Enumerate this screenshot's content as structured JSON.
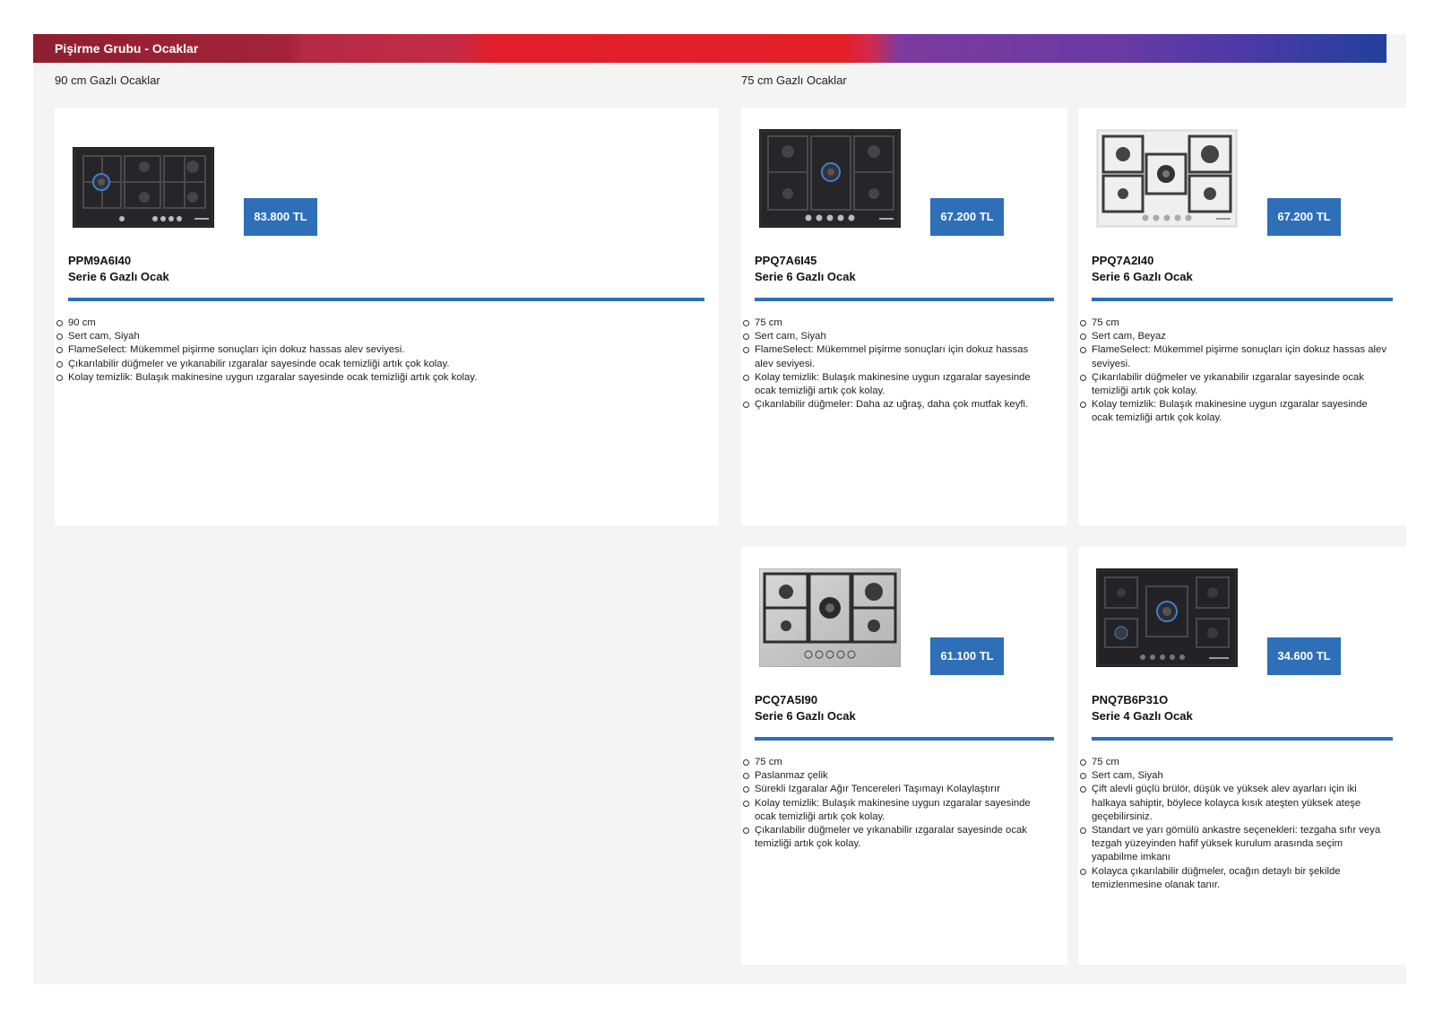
{
  "header": {
    "title": "Pişirme Grubu - Ocaklar"
  },
  "sections": {
    "left": "90 cm Gazlı Ocaklar",
    "right": "75 cm Gazlı Ocaklar"
  },
  "colors": {
    "accent": "#2e6fb7",
    "page_background": "#f4f4f5"
  },
  "products": [
    {
      "price": "83.800 TL",
      "model": "PPM9A6I40",
      "name": "Serie 6 Gazlı Ocak",
      "image": "black-glass-gas-hob",
      "features": [
        "90 cm",
        "Sert cam, Siyah",
        "FlameSelect: Mükemmel pişirme sonuçları için dokuz hassas alev seviyesi.",
        "Çıkarılabilir düğmeler ve yıkanabilir ızgaralar sayesinde ocak temizliği artık çok kolay.",
        "Kolay temizlik: Bulaşık makinesine uygun ızgaralar sayesinde ocak temizliği artık çok kolay."
      ]
    },
    {
      "price": "67.200 TL",
      "model": "PPQ7A6I45",
      "name": "Serie 6 Gazlı Ocak",
      "image": "black-glass-gas-hob",
      "features": [
        "75 cm",
        "Sert cam, Siyah",
        "FlameSelect: Mükemmel pişirme sonuçları için dokuz hassas alev seviyesi.",
        "Kolay temizlik: Bulaşık makinesine uygun ızgaralar sayesinde ocak temizliği artık çok kolay.",
        "Çıkarılabilir düğmeler: Daha az uğraş, daha çok mutfak keyfi."
      ]
    },
    {
      "price": "67.200 TL",
      "model": "PPQ7A2I40",
      "name": "Serie 6 Gazlı Ocak",
      "image": "white-glass-gas-hob",
      "features": [
        "75 cm",
        "Sert cam, Beyaz",
        "FlameSelect: Mükemmel pişirme sonuçları için dokuz hassas alev seviyesi.",
        "Çıkarılabilir düğmeler ve yıkanabilir ızgaralar sayesinde ocak temizliği artık çok kolay.",
        "Kolay temizlik: Bulaşık makinesine uygun ızgaralar sayesinde ocak temizliği artık çok kolay."
      ]
    },
    {
      "price": "61.100 TL",
      "model": "PCQ7A5I90",
      "name": "Serie 6 Gazlı Ocak",
      "image": "stainless-steel-gas-hob",
      "features": [
        "75 cm",
        "Paslanmaz çelik",
        "Sürekli Izgaralar Ağır Tencereleri Taşımayı Kolaylaştırır",
        "Kolay temizlik: Bulaşık makinesine uygun ızgaralar sayesinde ocak temizliği artık çok kolay.",
        "Çıkarılabilir düğmeler ve yıkanabilir ızgaralar sayesinde ocak temizliği artık çok kolay."
      ]
    },
    {
      "price": "34.600 TL",
      "model": "PNQ7B6P31O",
      "name": "Serie 4 Gazlı Ocak",
      "image": "black-glass-gas-hob",
      "features": [
        "75 cm",
        "Sert cam, Siyah",
        "Çift alevli güçlü brülör, düşük ve yüksek alev ayarları için iki halkaya sahiptir, böylece kolayca kısık ateşten yüksek ateşe geçebilirsiniz.",
        "Standart ve yarı gömülü ankastre seçenekleri: tezgaha sıfır veya tezgah yüzeyinden hafif yüksek kurulum arasında seçim yapabilme imkanı",
        "Kolayca çıkarılabilir düğmeler, ocağın detaylı bir şekilde temizlenmesine olanak tanır."
      ]
    }
  ]
}
